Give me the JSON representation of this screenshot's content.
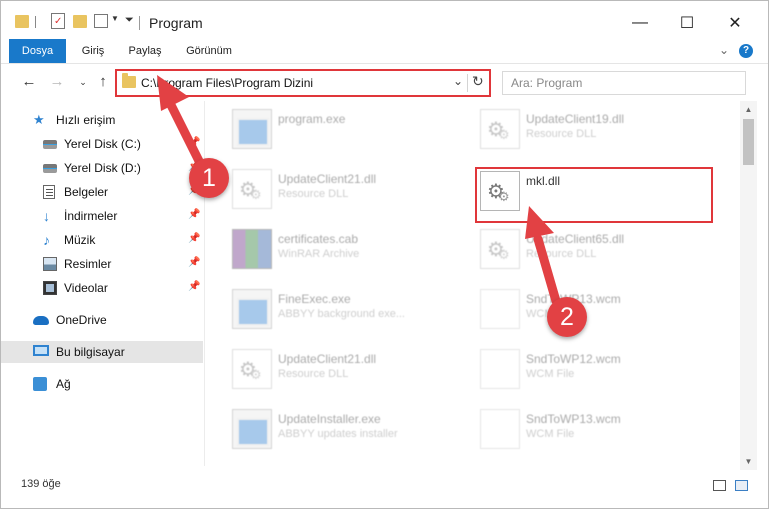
{
  "window": {
    "title": "Program"
  },
  "ribbon": {
    "tabs": [
      "Dosya",
      "Giriş",
      "Paylaş",
      "Görünüm"
    ]
  },
  "address": {
    "path": "C:\\Program Files\\Program Dizini"
  },
  "search": {
    "placeholder": "Ara: Program"
  },
  "sidebar": {
    "items": [
      {
        "label": "Hızlı erişim",
        "icon": "star-icon"
      },
      {
        "label": "Yerel Disk (C:)",
        "icon": "drive-icon"
      },
      {
        "label": "Yerel Disk (D:)",
        "icon": "drive-icon"
      },
      {
        "label": "Belgeler",
        "icon": "documents-icon"
      },
      {
        "label": "İndirmeler",
        "icon": "download-icon"
      },
      {
        "label": "Müzik",
        "icon": "music-icon"
      },
      {
        "label": "Resimler",
        "icon": "pictures-icon"
      },
      {
        "label": "Videolar",
        "icon": "videos-icon"
      },
      {
        "label": "OneDrive",
        "icon": "cloud-icon"
      },
      {
        "label": "Bu bilgisayar",
        "icon": "computer-icon"
      },
      {
        "label": "Ağ",
        "icon": "network-icon"
      }
    ]
  },
  "files": {
    "left": [
      {
        "name": "program.exe",
        "type": "",
        "icon": "exe-icon"
      },
      {
        "name": "UpdateClient21.dll",
        "type": "Resource DLL",
        "icon": "dll-icon"
      },
      {
        "name": "certificates.cab",
        "type": "WinRAR Archive",
        "icon": "archive-icon"
      },
      {
        "name": "FineExec.exe",
        "type": "ABBYY background exe...",
        "icon": "exe-icon"
      },
      {
        "name": "UpdateClient21.dll",
        "type": "Resource DLL",
        "icon": "dll-icon"
      },
      {
        "name": "UpdateInstaller.exe",
        "type": "ABBYY updates installer",
        "icon": "exe-icon"
      }
    ],
    "right": [
      {
        "name": "UpdateClient19.dll",
        "type": "Resource DLL",
        "icon": "dll-icon"
      },
      {
        "name": "mkl.dll",
        "type": "",
        "icon": "dll-icon"
      },
      {
        "name": "UpdateClient65.dll",
        "type": "Resource DLL",
        "icon": "dll-icon"
      },
      {
        "name": "SndToWP13.wcm",
        "type": "WCM File",
        "icon": "file-icon"
      },
      {
        "name": "SndToWP12.wcm",
        "type": "WCM File",
        "icon": "file-icon"
      },
      {
        "name": "SndToWP13.wcm",
        "type": "WCM File",
        "icon": "file-icon"
      }
    ]
  },
  "status": {
    "count": "139 öğe"
  },
  "callouts": [
    "1",
    "2"
  ],
  "colors": {
    "accent": "#1979ca",
    "highlight": "#e0363a",
    "callout": "#e24144"
  }
}
